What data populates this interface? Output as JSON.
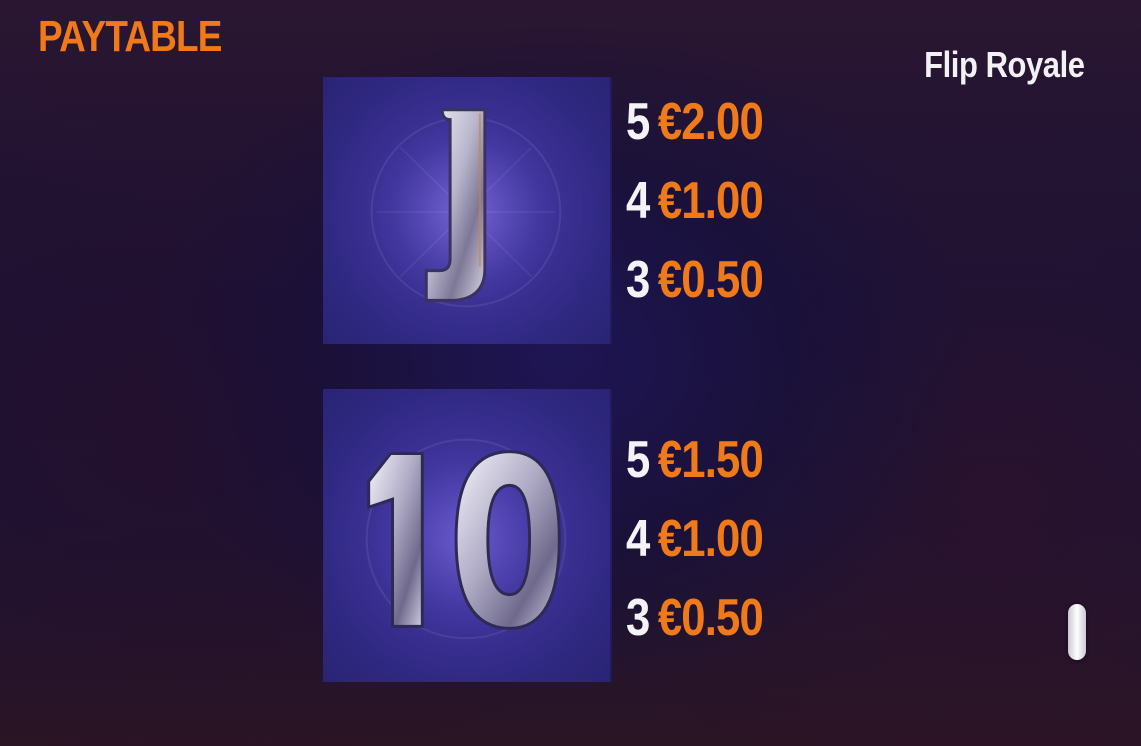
{
  "header": {
    "title": "PAYTABLE",
    "game_name": "Flip Royale"
  },
  "symbols": [
    {
      "symbol": "J",
      "icon": "jack-card-symbol",
      "payouts": [
        {
          "count": "5",
          "amount": "€2.00"
        },
        {
          "count": "4",
          "amount": "€1.00"
        },
        {
          "count": "3",
          "amount": "€0.50"
        }
      ]
    },
    {
      "symbol": "10",
      "icon": "ten-card-symbol",
      "payouts": [
        {
          "count": "5",
          "amount": "€1.50"
        },
        {
          "count": "4",
          "amount": "€1.00"
        },
        {
          "count": "3",
          "amount": "€0.50"
        }
      ]
    }
  ],
  "colors": {
    "accent": "#f07a1a",
    "text": "#f4f4f6",
    "tile": "#3f349c"
  },
  "scrollbar": {
    "position_fraction": 0.95
  }
}
